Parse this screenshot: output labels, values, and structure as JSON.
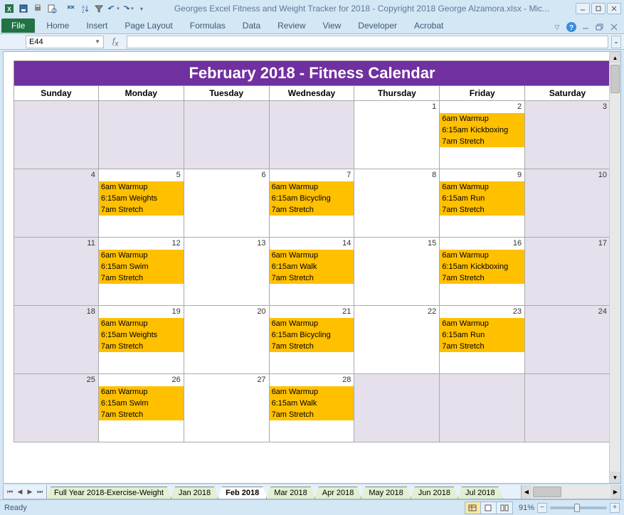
{
  "window": {
    "title": "Georges Excel Fitness and Weight Tracker for 2018 - Copyright 2018 George Alzamora.xlsx  -  Mic..."
  },
  "ribbon": {
    "file": "File",
    "tabs": [
      "Home",
      "Insert",
      "Page Layout",
      "Formulas",
      "Data",
      "Review",
      "View",
      "Developer",
      "Acrobat"
    ]
  },
  "namebox": {
    "value": "E44"
  },
  "formula_bar": {
    "value": ""
  },
  "calendar": {
    "title": "February 2018  -  Fitness Calendar",
    "dow": [
      "Sunday",
      "Monday",
      "Tuesday",
      "Wednesday",
      "Thursday",
      "Friday",
      "Saturday"
    ],
    "cells": [
      {
        "shaded": true
      },
      {
        "shaded": true
      },
      {
        "shaded": true
      },
      {
        "day": 1
      },
      {
        "day": 2,
        "events": [
          "6am Warmup",
          "6:15am Kickboxing",
          "7am Stretch"
        ]
      },
      {
        "day": 3,
        "shaded": true
      },
      {
        "day": 4,
        "shaded": true
      },
      {
        "day": 5,
        "events": [
          "6am Warmup",
          "6:15am Weights",
          "7am Stretch"
        ]
      },
      {
        "day": 6
      },
      {
        "day": 7,
        "events": [
          "6am Warmup",
          "6:15am Bicycling",
          "7am Stretch"
        ]
      },
      {
        "day": 8
      },
      {
        "day": 9,
        "events": [
          "6am Warmup",
          "6:15am Run",
          "7am Stretch"
        ]
      },
      {
        "day": 10,
        "shaded": true
      },
      {
        "day": 11,
        "shaded": true
      },
      {
        "day": 12,
        "events": [
          "6am Warmup",
          "6:15am Swim",
          "7am Stretch"
        ]
      },
      {
        "day": 13
      },
      {
        "day": 14,
        "events": [
          "6am Warmup",
          "6:15am Walk",
          "7am Stretch"
        ]
      },
      {
        "day": 15
      },
      {
        "day": 16,
        "events": [
          "6am Warmup",
          "6:15am Kickboxing",
          "7am Stretch"
        ]
      },
      {
        "day": 17,
        "shaded": true
      },
      {
        "day": 18,
        "shaded": true
      },
      {
        "day": 19,
        "events": [
          "6am Warmup",
          "6:15am Weights",
          "7am Stretch"
        ]
      },
      {
        "day": 20
      },
      {
        "day": 21,
        "events": [
          "6am Warmup",
          "6:15am Bicycling",
          "7am Stretch"
        ]
      },
      {
        "day": 22
      },
      {
        "day": 23,
        "events": [
          "6am Warmup",
          "6:15am Run",
          "7am Stretch"
        ]
      },
      {
        "day": 24,
        "shaded": true
      },
      {
        "day": 25,
        "shaded": true
      },
      {
        "day": 26,
        "events": [
          "6am Warmup",
          "6:15am Swim",
          "7am Stretch"
        ]
      },
      {
        "day": 27
      },
      {
        "day": 28,
        "events": [
          "6am Warmup",
          "6:15am Walk",
          "7am Stretch"
        ]
      },
      {
        "shaded": true
      },
      {
        "shaded": true
      },
      {
        "shaded": true
      }
    ]
  },
  "sheet_tabs": {
    "tabs": [
      "Full Year 2018-Exercise-Weight",
      "Jan 2018",
      "Feb 2018",
      "Mar 2018",
      "Apr 2018",
      "May 2018",
      "Jun 2018",
      "Jul 2018"
    ],
    "active": "Feb 2018"
  },
  "statusbar": {
    "status": "Ready",
    "zoom": "91%"
  }
}
